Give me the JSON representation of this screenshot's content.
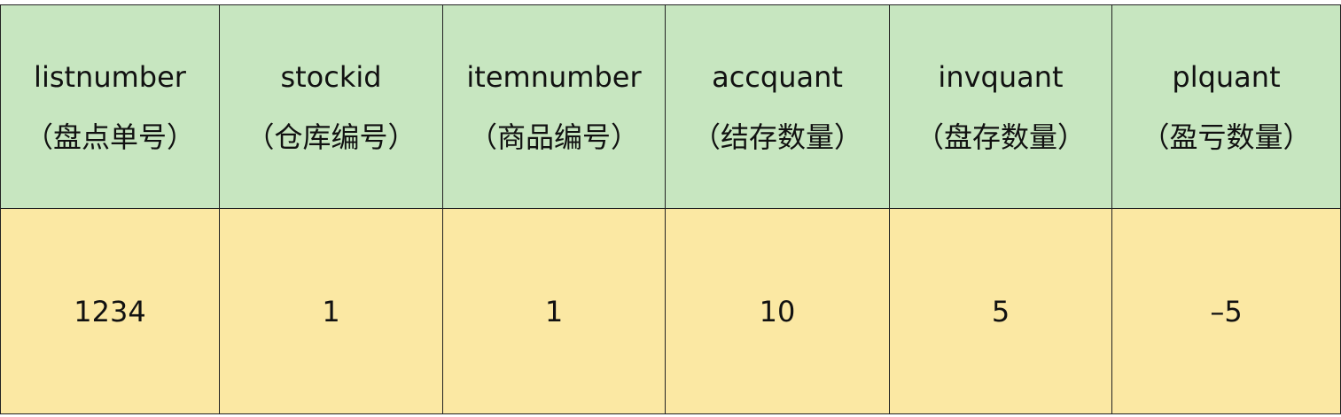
{
  "table": {
    "headers": [
      {
        "name": "listnumber",
        "label": "（盘点单号）"
      },
      {
        "name": "stockid",
        "label": "（仓库编号）"
      },
      {
        "name": "itemnumber",
        "label": "（商品编号）"
      },
      {
        "name": "accquant",
        "label": "（结存数量）"
      },
      {
        "name": "invquant",
        "label": "（盘存数量）"
      },
      {
        "name": "plquant",
        "label": "（盈亏数量）"
      }
    ],
    "rows": [
      [
        "1234",
        "1",
        "1",
        "10",
        "5",
        "–5"
      ]
    ]
  },
  "colors": {
    "header_bg": "#c7e6c0",
    "row_bg": "#fbe8a3",
    "border": "#222222"
  }
}
